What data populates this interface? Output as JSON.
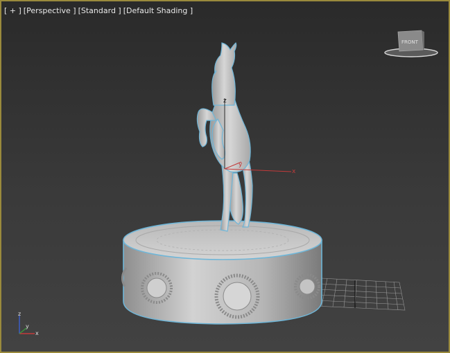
{
  "viewport": {
    "menu_label": "[ + ]",
    "view_label": "[Perspective ]",
    "mode_label": "[Standard ]",
    "shading_label": "[Default Shading ]"
  },
  "viewcube": {
    "face_label": "FRONT"
  },
  "gizmo": {
    "x_label": "x",
    "y_label": "y",
    "z_label": "z"
  },
  "axis_tripod": {
    "z_label": "z",
    "x_label": "x",
    "y_label": "y"
  },
  "colors": {
    "border": "#9a8a3c",
    "model": "#c9c9c9",
    "selection_outline": "#6fb6d8",
    "gizmo_axis": "#c43a3a"
  }
}
